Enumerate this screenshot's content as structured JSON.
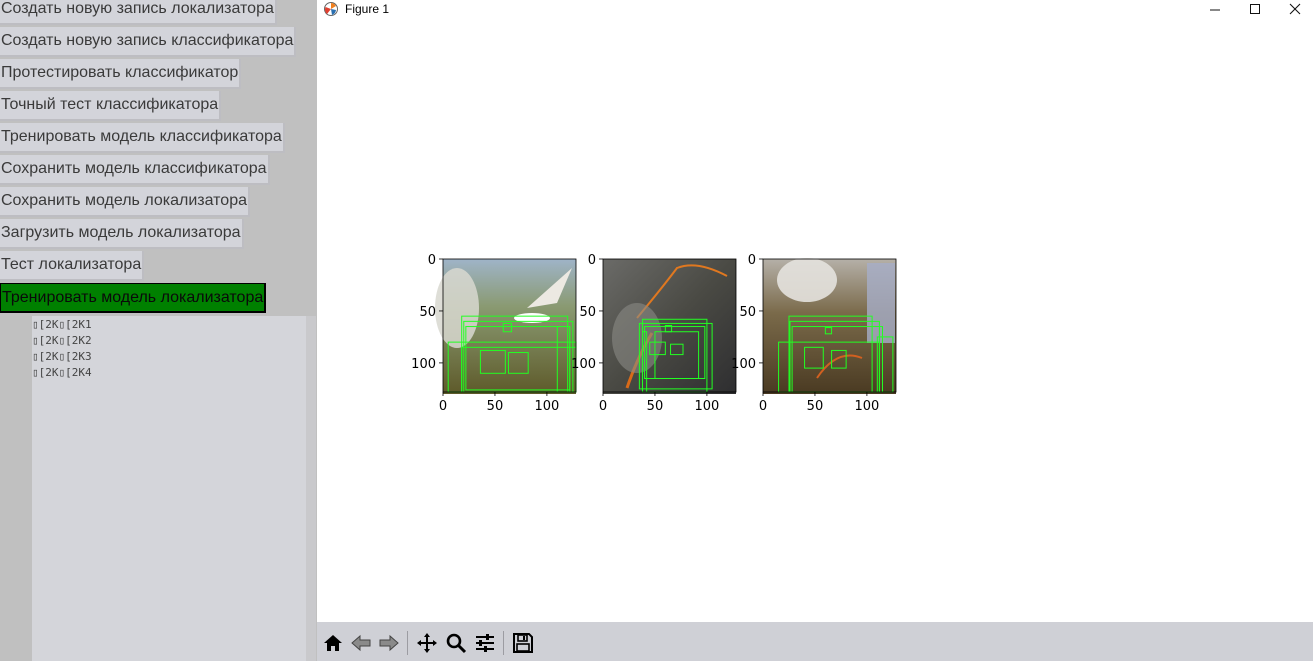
{
  "left_panel": {
    "buttons": [
      {
        "label": "Создать новую запись локализатора",
        "active": false
      },
      {
        "label": "Создать новую запись классификатора",
        "active": false
      },
      {
        "label": "Протестировать классификатор",
        "active": false
      },
      {
        "label": "Точный тест классификатора",
        "active": false
      },
      {
        "label": "Тренировать модель классификатора",
        "active": false
      },
      {
        "label": "Сохранить модель классификатора",
        "active": false
      },
      {
        "label": "Сохранить модель локализатора",
        "active": false
      },
      {
        "label": "Загрузить модель локализатора",
        "active": false
      },
      {
        "label": "Тест локализатора",
        "active": false
      },
      {
        "label": "Тренировать модель локализатора",
        "active": true
      }
    ],
    "log_lines": [
      "▯[2K▯[2K1",
      "▯[2K▯[2K2",
      "▯[2K▯[2K3",
      "▯[2K▯[2K4"
    ]
  },
  "figure_window": {
    "title": "Figure 1",
    "controls": {
      "minimize": "—",
      "maximize": "☐",
      "close": "✕"
    },
    "toolbar": [
      "home-icon",
      "back-icon",
      "forward-icon",
      "pan-icon",
      "zoom-icon",
      "configure-subplots-icon",
      "save-icon"
    ]
  },
  "chart_data": [
    {
      "type": "image",
      "x_ticks": [
        0,
        50,
        100
      ],
      "y_ticks": [
        0,
        50,
        100
      ],
      "xlim": [
        0,
        128
      ],
      "ylim": [
        128,
        0
      ],
      "box_color": "#22ff22",
      "boxes": [
        [
          18,
          55,
          120,
          128
        ],
        [
          20,
          60,
          125,
          128
        ],
        [
          22,
          65,
          122,
          126
        ],
        [
          5,
          80,
          128,
          128
        ],
        [
          18,
          85,
          128,
          128
        ],
        [
          36,
          88,
          60,
          110
        ],
        [
          63,
          90,
          82,
          110
        ],
        [
          58,
          62,
          66,
          70
        ],
        [
          110,
          65,
          122,
          128
        ]
      ]
    },
    {
      "type": "image",
      "x_ticks": [
        0,
        50,
        100
      ],
      "y_ticks": [
        0,
        50,
        100
      ],
      "xlim": [
        0,
        128
      ],
      "ylim": [
        128,
        0
      ],
      "box_color": "#22ff22",
      "boxes": [
        [
          38,
          58,
          100,
          128
        ],
        [
          35,
          62,
          105,
          125
        ],
        [
          40,
          65,
          98,
          115
        ],
        [
          50,
          70,
          92,
          115
        ],
        [
          45,
          80,
          60,
          92
        ],
        [
          65,
          82,
          77,
          92
        ],
        [
          60,
          64,
          66,
          70
        ],
        [
          38,
          70,
          42,
          128
        ]
      ]
    },
    {
      "type": "image",
      "x_ticks": [
        0,
        50,
        100
      ],
      "y_ticks": [
        0,
        50,
        100
      ],
      "xlim": [
        0,
        128
      ],
      "ylim": [
        128,
        0
      ],
      "box_color": "#22ff22",
      "boxes": [
        [
          25,
          55,
          105,
          128
        ],
        [
          26,
          60,
          112,
          128
        ],
        [
          28,
          65,
          115,
          128
        ],
        [
          15,
          80,
          112,
          128
        ],
        [
          40,
          85,
          58,
          105
        ],
        [
          66,
          88,
          80,
          105
        ],
        [
          60,
          66,
          66,
          72
        ],
        [
          110,
          75,
          125,
          128
        ]
      ]
    }
  ]
}
